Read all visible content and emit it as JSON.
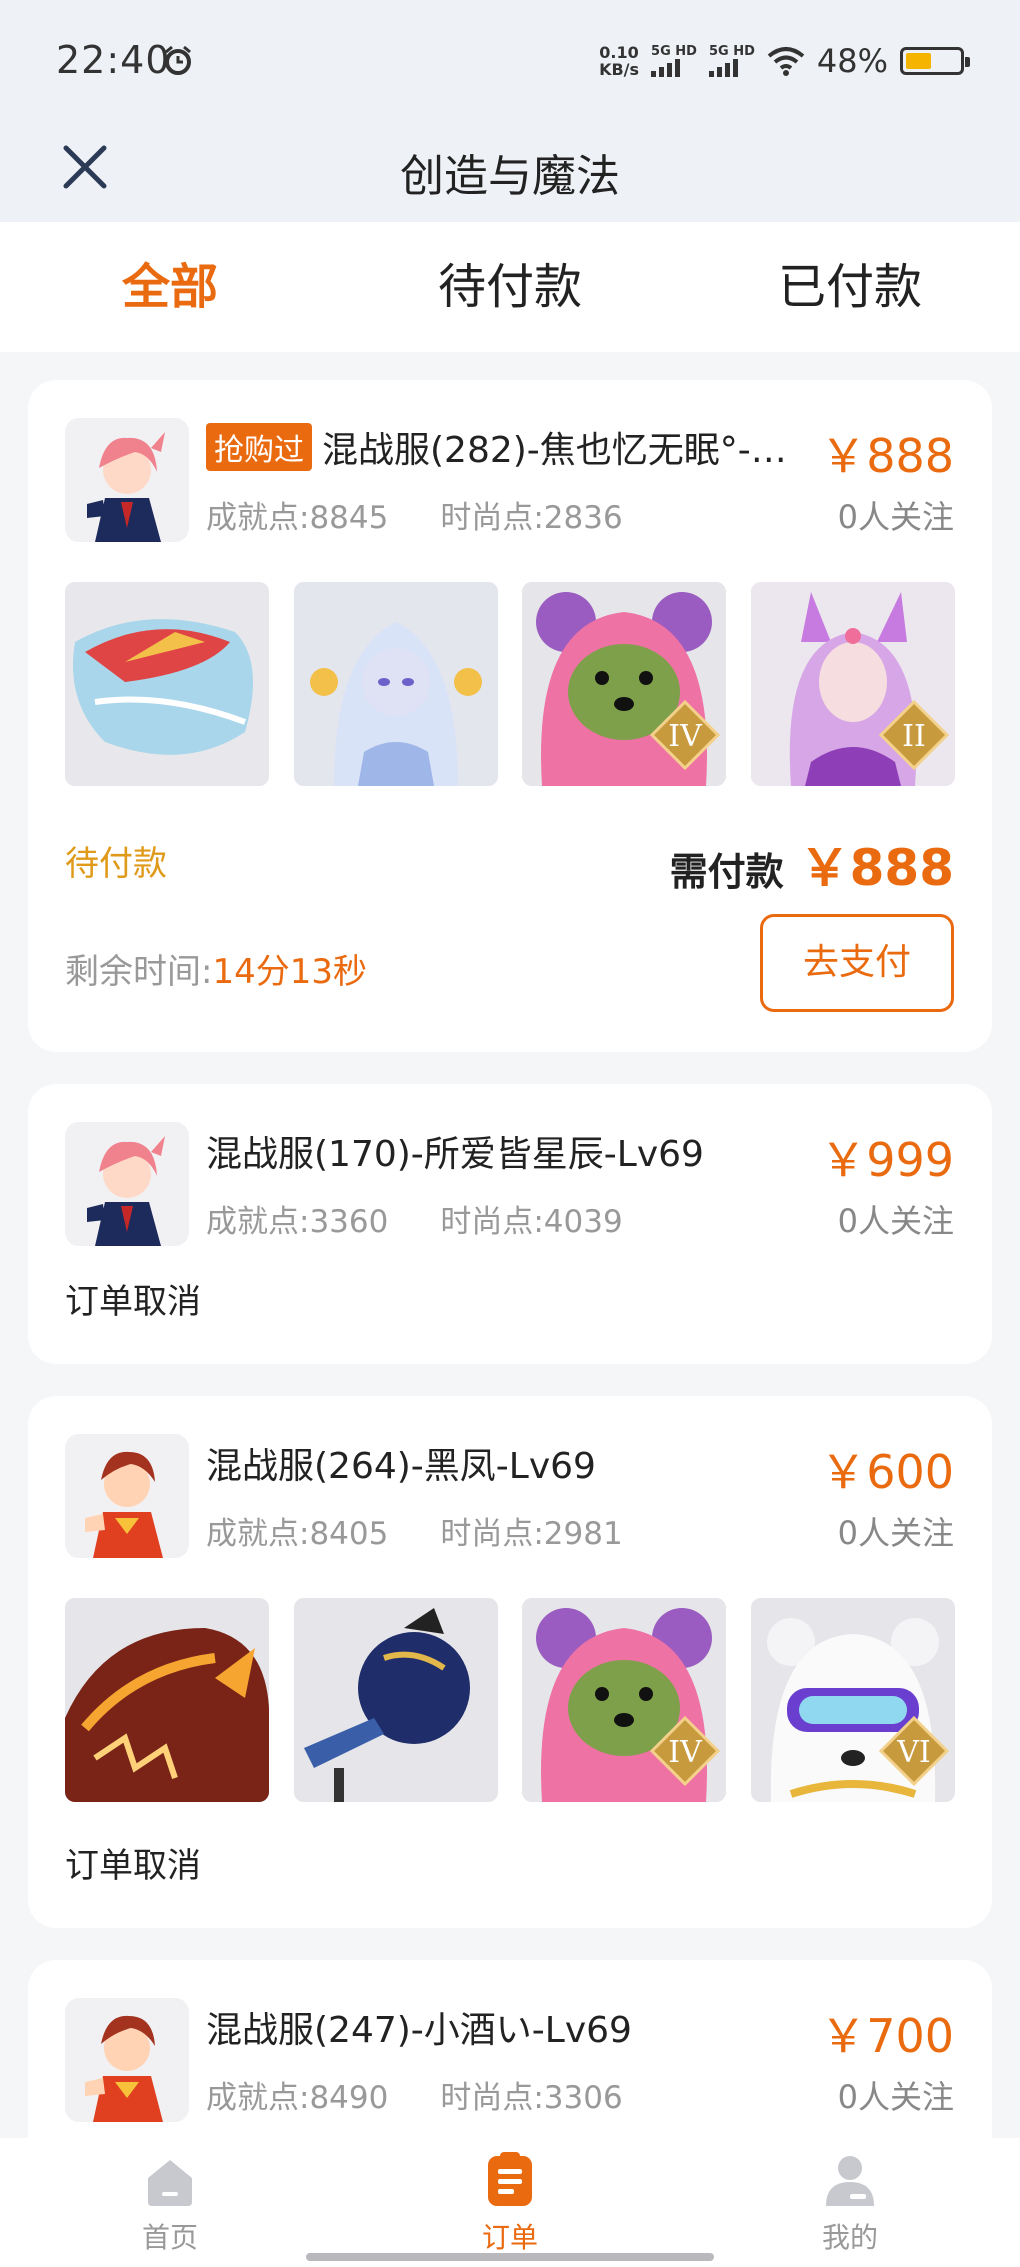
{
  "status_bar": {
    "time": "22:40",
    "net_speed_value": "0.10",
    "net_speed_unit": "KB/s",
    "sim1_label": "5G HD",
    "sim2_label": "5G HD",
    "battery_pct": "48%",
    "battery_level": 0.48,
    "icons": [
      "alarm-icon",
      "signal-icon",
      "wifi-icon",
      "battery-icon"
    ]
  },
  "header": {
    "title": "创造与魔法",
    "close_icon": "close-icon"
  },
  "tabs": [
    {
      "label": "全部",
      "active": true
    },
    {
      "label": "待付款",
      "active": false
    },
    {
      "label": "已付款",
      "active": false
    }
  ],
  "orders": [
    {
      "tag": "抢购过",
      "title": "混战服(282)-焦也忆无眠°-…",
      "price": "￥888",
      "follow": "0人关注",
      "achievement": "成就点:8845",
      "fashion": "时尚点:2836",
      "thumb_badges": [
        "",
        "",
        "IV",
        "II"
      ],
      "status": "待付款",
      "need_pay_label": "需付款",
      "need_pay_amount": "￥888",
      "remain_label": "剩余时间:",
      "remain_value": "14分13秒",
      "pay_button": "去支付"
    },
    {
      "title": "混战服(170)-所爱皆星辰-Lv69",
      "price": "￥999",
      "follow": "0人关注",
      "achievement": "成就点:3360",
      "fashion": "时尚点:4039",
      "status": "订单取消"
    },
    {
      "title": "混战服(264)-黑凤-Lv69",
      "price": "￥600",
      "follow": "0人关注",
      "achievement": "成就点:8405",
      "fashion": "时尚点:2981",
      "thumb_badges": [
        "",
        "",
        "IV",
        "VI"
      ],
      "status": "订单取消"
    },
    {
      "title": "混战服(247)-小酒い-Lv69",
      "price": "￥700",
      "follow": "0人关注",
      "achievement": "成就点:8490",
      "fashion": "时尚点:3306"
    }
  ],
  "bottom_nav": [
    {
      "label": "首页",
      "icon": "home-icon",
      "active": false
    },
    {
      "label": "订单",
      "icon": "order-icon",
      "active": true
    },
    {
      "label": "我的",
      "icon": "profile-icon",
      "active": false
    }
  ],
  "colors": {
    "accent": "#ea6a0f",
    "pending": "#e09a1a",
    "background": "#f5f6f8"
  }
}
